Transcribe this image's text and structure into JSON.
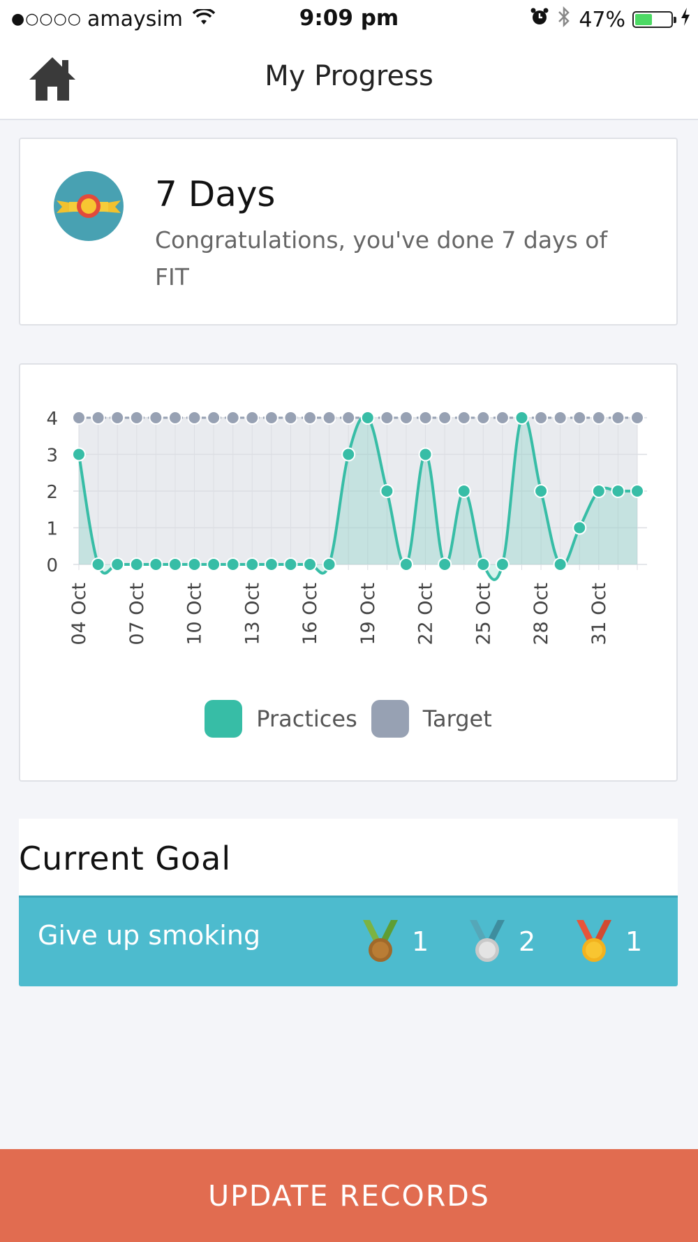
{
  "status_bar": {
    "signal_dots": "●○○○○",
    "carrier": "amaysim",
    "time": "9:09 pm",
    "battery": "47%",
    "battery_level": 0.47
  },
  "nav": {
    "title": "My Progress",
    "home_icon": "home-icon"
  },
  "streak": {
    "title": "7 Days",
    "message": "Congratulations, you've done 7 days of FIT",
    "icon": "award-ribbon-icon"
  },
  "chart_data": {
    "type": "area",
    "y_ticks": [
      "0",
      "1",
      "2",
      "3",
      "4"
    ],
    "ylim": [
      0,
      4
    ],
    "x_tick_labels": [
      "04 Oct",
      "07 Oct",
      "10 Oct",
      "13 Oct",
      "16 Oct",
      "19 Oct",
      "22 Oct",
      "25 Oct",
      "28 Oct",
      "31 Oct"
    ],
    "x": [
      "04 Oct",
      "05 Oct",
      "06 Oct",
      "07 Oct",
      "08 Oct",
      "09 Oct",
      "10 Oct",
      "11 Oct",
      "12 Oct",
      "13 Oct",
      "14 Oct",
      "15 Oct",
      "16 Oct",
      "17 Oct",
      "18 Oct",
      "19 Oct",
      "20 Oct",
      "21 Oct",
      "22 Oct",
      "23 Oct",
      "24 Oct",
      "25 Oct",
      "26 Oct",
      "27 Oct",
      "28 Oct",
      "29 Oct",
      "30 Oct",
      "31 Oct",
      "01 Nov",
      "02 Nov"
    ],
    "series": [
      {
        "name": "Practices",
        "color": "#37bda6",
        "values": [
          3,
          0,
          0,
          0,
          0,
          0,
          0,
          0,
          0,
          0,
          0,
          0,
          0,
          0,
          3,
          4,
          2,
          0,
          3,
          0,
          2,
          0,
          0,
          4,
          2,
          0,
          1,
          2,
          2,
          2
        ]
      },
      {
        "name": "Target",
        "color": "#97a1b3",
        "values": [
          4,
          4,
          4,
          4,
          4,
          4,
          4,
          4,
          4,
          4,
          4,
          4,
          4,
          4,
          4,
          4,
          4,
          4,
          4,
          4,
          4,
          4,
          4,
          4,
          4,
          4,
          4,
          4,
          4,
          4
        ]
      }
    ],
    "grid": true,
    "legend_position": "bottom"
  },
  "goal": {
    "heading": "Current Goal",
    "name": "Give up smoking",
    "medals": [
      {
        "icon": "bronze-medal-icon",
        "count": "1"
      },
      {
        "icon": "silver-medal-icon",
        "count": "2"
      },
      {
        "icon": "gold-medal-icon",
        "count": "1"
      }
    ]
  },
  "actions": {
    "update_label": "UPDATE RECORDS"
  },
  "colors": {
    "accent_teal": "#4dbbce",
    "button_orange": "#e16c50",
    "practices": "#37bda6",
    "target": "#97a1b3"
  }
}
